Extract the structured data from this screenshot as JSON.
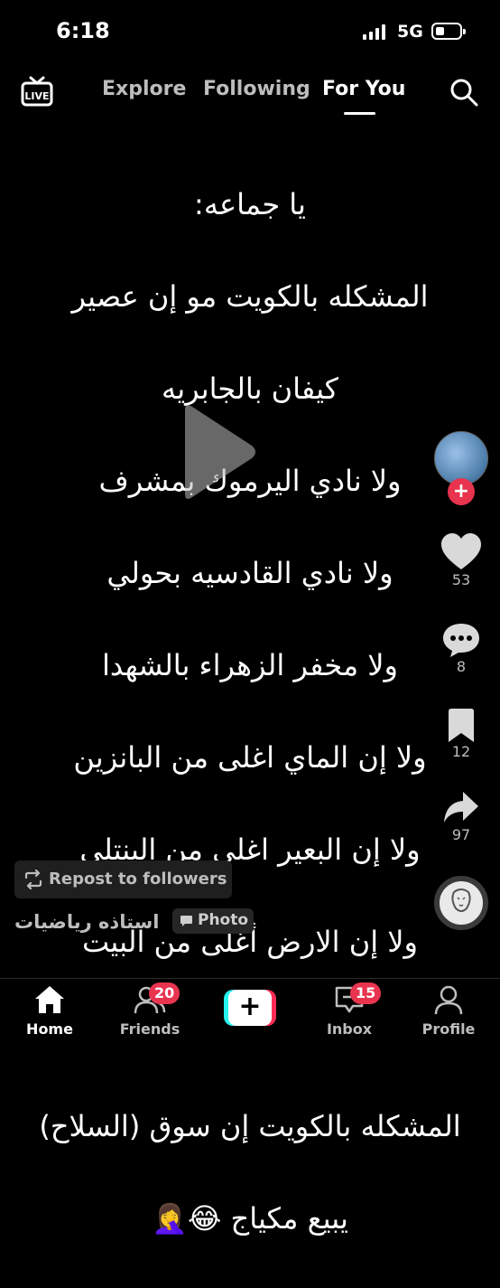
{
  "status_bar": {
    "time": "6:18",
    "network": "5G"
  },
  "top_nav": {
    "live_label": "LIVE",
    "tabs": [
      {
        "label": "Explore",
        "active": false
      },
      {
        "label": "Following",
        "active": false
      },
      {
        "label": "For You",
        "active": true
      }
    ]
  },
  "post": {
    "lines": [
      "يا جماعه:",
      "المشكله بالكويت  مو إن عصير",
      "كيفان بالجابريه",
      "ولا نادي اليرموك بمشرف",
      "ولا نادي القادسيه بحولي",
      "ولا مخفر الزهراء بالشهدا",
      "ولا إن الماي اغلى من البانزين",
      "ولا إن البعير اغلى من البنتلي",
      "ولا إن الارض أغلى من البيت",
      "",
      "المشكله بالكويت إن سوق (السلاح)",
      "يبيع مكياج 😂🤦‍♀️"
    ]
  },
  "rail": {
    "likes": "53",
    "comments": "8",
    "saves": "12",
    "shares": "97"
  },
  "footer": {
    "repost_label": "Repost to followers",
    "author": "استاذه رياضيات",
    "photo_label": "Photo"
  },
  "bottom_nav": {
    "items": [
      {
        "label": "Home",
        "active": true
      },
      {
        "label": "Friends",
        "badge": "20"
      },
      {
        "label": "Inbox",
        "badge": "15"
      },
      {
        "label": "Profile"
      }
    ]
  },
  "colors": {
    "accent_red": "#fe2c55",
    "accent_cyan": "#25f4ee",
    "badge_red": "#e8344f"
  }
}
